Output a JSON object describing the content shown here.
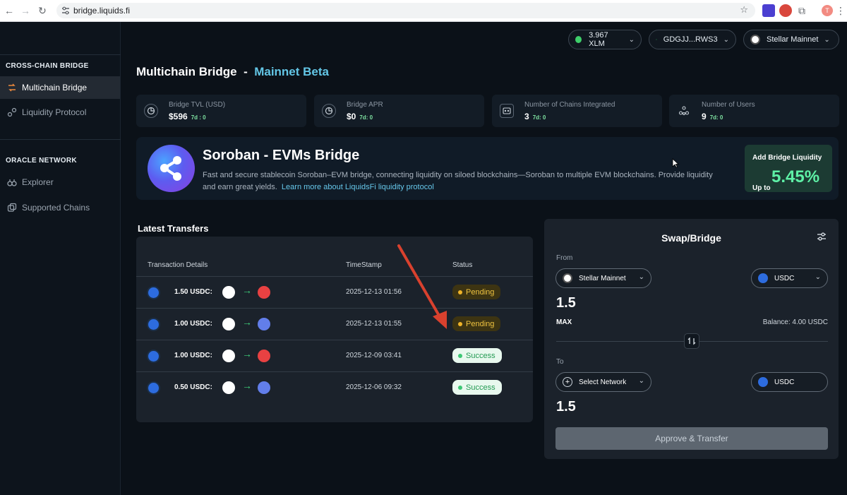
{
  "browser": {
    "url": "bridge.liquids.fi",
    "profile_initial": "T"
  },
  "sidebar": {
    "section_bridge": "CROSS-CHAIN BRIDGE",
    "section_oracle": "ORACLE NETWORK",
    "items": [
      {
        "label": "Multichain Bridge"
      },
      {
        "label": "Liquidity Protocol"
      },
      {
        "label": "Explorer"
      },
      {
        "label": "Supported Chains"
      }
    ]
  },
  "topbar": {
    "balance": "3.967 XLM",
    "wallet": "GDGJJ...RWS3",
    "network": "Stellar Mainnet"
  },
  "page": {
    "title": "Multichain Bridge",
    "separator": "-",
    "beta": "Mainnet Beta"
  },
  "stats": [
    {
      "label": "Bridge TVL (USD)",
      "value": "$596",
      "delta": "7d : 0"
    },
    {
      "label": "Bridge APR",
      "value": "$0",
      "delta": "7d: 0"
    },
    {
      "label": "Number of Chains Integrated",
      "value": "3",
      "delta": "7d: 0"
    },
    {
      "label": "Number of Users",
      "value": "9",
      "delta": "7d: 0"
    }
  ],
  "banner": {
    "title": "Soroban - EVMs Bridge",
    "desc": "Fast and secure stablecoin Soroban–EVM bridge, connecting liquidity on siloed blockchains—Soroban to multiple EVM blockchains. Provide liquidity and earn great yields.",
    "link": "Learn more about LiquidsFi liquidity protocol",
    "cta_title": "Add Bridge Liquidity",
    "cta_prefix": "Up to",
    "cta_pct": "5.45%"
  },
  "transfers": {
    "title": "Latest Transfers",
    "headers": {
      "details": "Transaction Details",
      "timestamp": "TimeStamp",
      "status": "Status"
    },
    "rows": [
      {
        "amount": "1.50 USDC:",
        "dest": "avalanche",
        "timestamp": "2025-12-13 01:56",
        "status": "Pending"
      },
      {
        "amount": "1.00 USDC:",
        "dest": "ethereum",
        "timestamp": "2025-12-13 01:55",
        "status": "Pending"
      },
      {
        "amount": "1.00 USDC:",
        "dest": "avalanche",
        "timestamp": "2025-12-09 03:41",
        "status": "Success"
      },
      {
        "amount": "0.50 USDC:",
        "dest": "ethereum",
        "timestamp": "2025-12-06 09:32",
        "status": "Success"
      }
    ]
  },
  "swap": {
    "title": "Swap/Bridge",
    "from_label": "From",
    "from_network": "Stellar Mainnet",
    "from_token": "USDC",
    "from_amount": "1.5",
    "max_label": "MAX",
    "balance": "Balance: 4.00 USDC",
    "to_label": "To",
    "to_network": "Select Network",
    "to_token": "USDC",
    "to_amount": "1.5",
    "button": "Approve & Transfer"
  },
  "colors": {
    "accent": "#63c6e6",
    "pending": "#f0c440",
    "success": "#229a52",
    "apr_green": "#5ef0a6"
  }
}
